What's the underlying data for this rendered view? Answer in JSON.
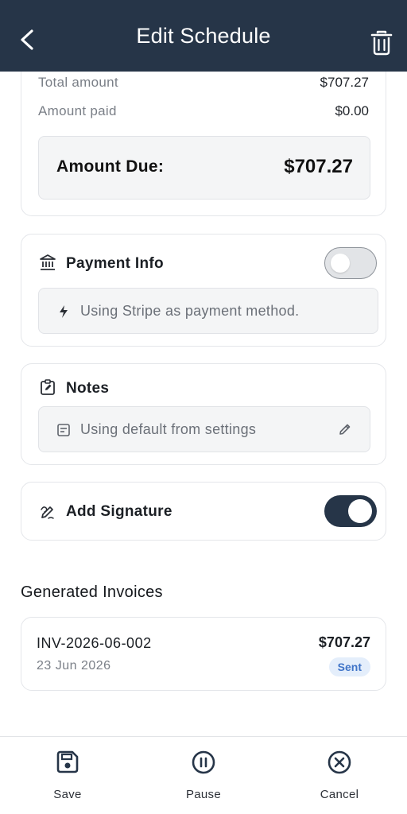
{
  "header": {
    "title": "Edit Schedule"
  },
  "summary": {
    "total_label": "Total amount",
    "total_value": "$707.27",
    "paid_label": "Amount paid",
    "paid_value": "$0.00",
    "due_label": "Amount Due:",
    "due_value": "$707.27"
  },
  "payment": {
    "title": "Payment Info",
    "toggle_on": false,
    "info_text": "Using Stripe as payment method."
  },
  "notes": {
    "title": "Notes",
    "info_text": "Using default from settings"
  },
  "signature": {
    "title": "Add Signature",
    "toggle_on": true
  },
  "invoices": {
    "section_title": "Generated Invoices",
    "items": [
      {
        "number": "INV-2026-06-002",
        "date": "23 Jun 2026",
        "amount": "$707.27",
        "status": "Sent"
      }
    ]
  },
  "bottom_bar": {
    "save_label": "Save",
    "pause_label": "Pause",
    "cancel_label": "Cancel"
  },
  "colors": {
    "header_bg": "#263548",
    "toggle_on": "#263548",
    "badge_bg": "#e4eefb",
    "badge_text": "#3f74c8"
  }
}
